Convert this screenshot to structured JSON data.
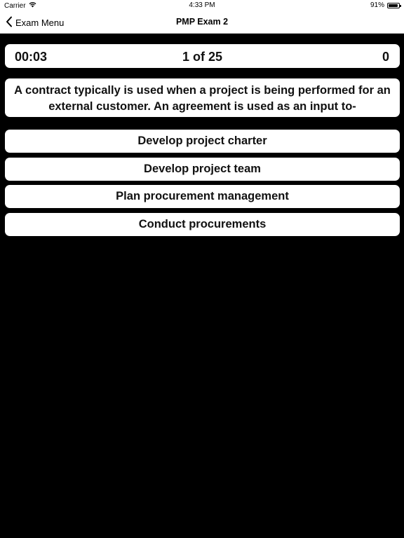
{
  "status_bar": {
    "carrier": "Carrier",
    "time": "4:33 PM",
    "battery_percent": "91%",
    "battery_level": 0.91
  },
  "nav": {
    "back_label": "Exam Menu",
    "title": "PMP Exam 2"
  },
  "quiz": {
    "timer": "00:03",
    "progress": "1 of 25",
    "score": "0",
    "question": "A contract typically is used when a project is being performed for an external customer. An agreement is used as an input to-",
    "answers": [
      "Develop project charter",
      "Develop project team",
      "Plan procurement management",
      "Conduct procurements"
    ]
  },
  "colors": {
    "background": "#000000",
    "card": "#ffffff",
    "text": "#111111"
  }
}
